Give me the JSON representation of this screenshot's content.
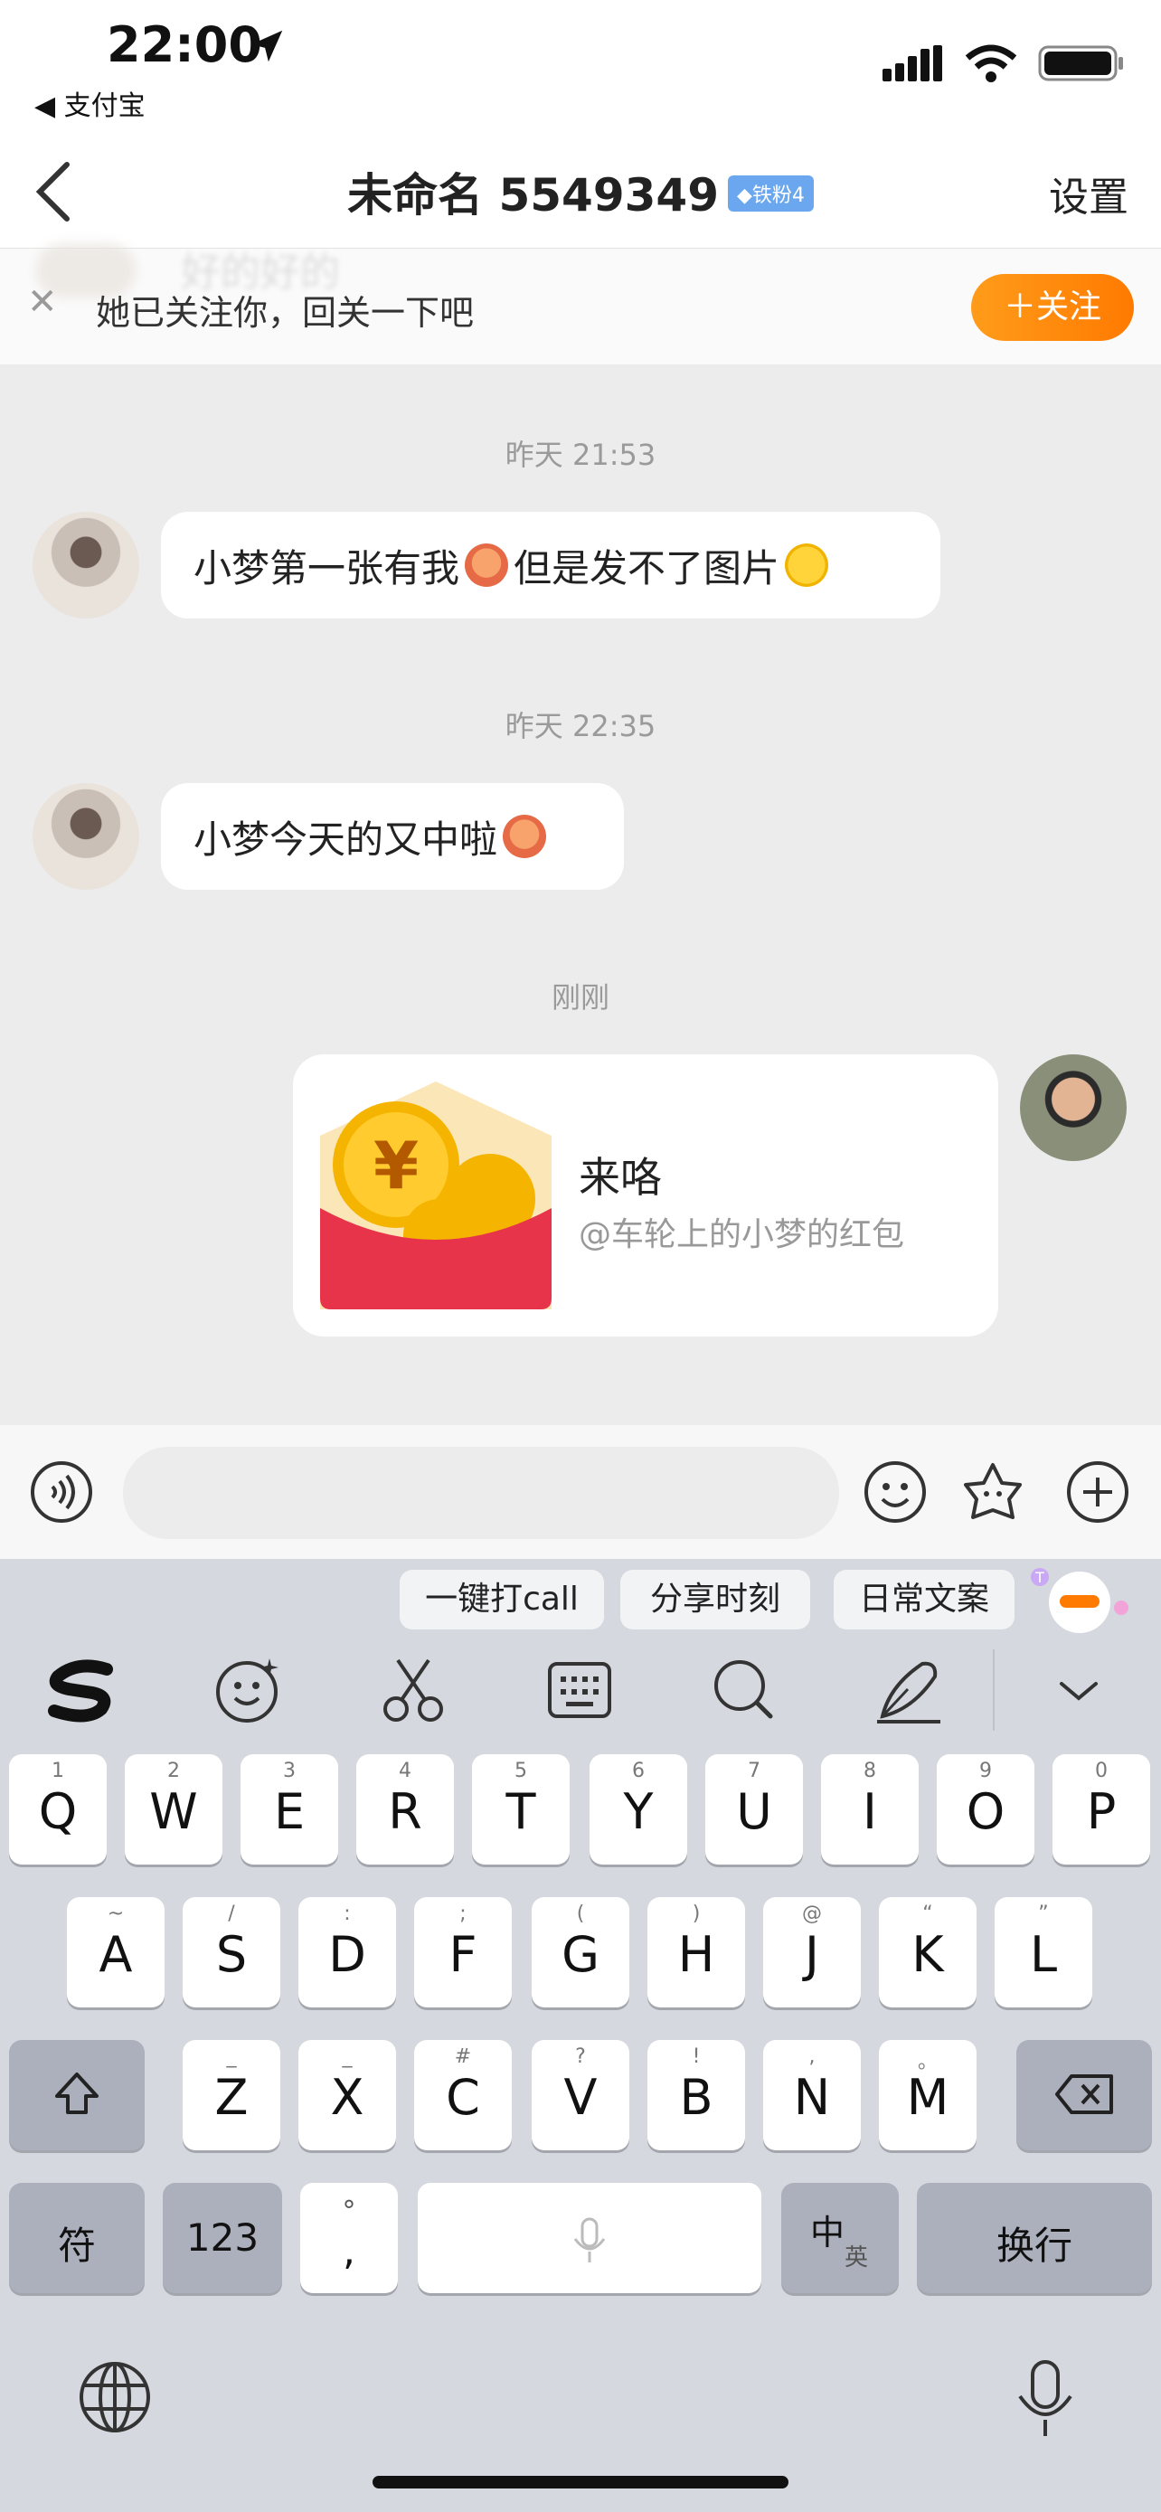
{
  "status_bar": {
    "time": "22:00",
    "back_app": "◀ 支付宝"
  },
  "nav": {
    "title": "未命名 5549349",
    "fan_badge": "◆铁粉4",
    "settings": "设置"
  },
  "follow_banner": {
    "blurred_text": "好的好的",
    "text": "她已关注你，回关一下吧",
    "follow_button": "＋关注"
  },
  "messages": [
    {
      "timestamp": "昨天 21:53",
      "text_before": "小梦第一张有我",
      "text_after": "但是发不了图片"
    },
    {
      "timestamp": "昨天 22:35",
      "text": "小梦今天的又中啦"
    },
    {
      "timestamp": "刚刚",
      "red_packet": {
        "title": "来咯",
        "subtitle": "@车轮上的小梦的红包"
      }
    }
  ],
  "input": {
    "placeholder": ""
  },
  "keyboard": {
    "suggestions": [
      "一键打call",
      "分享时刻",
      "日常文案"
    ],
    "row1": [
      {
        "k": "Q",
        "h": "1"
      },
      {
        "k": "W",
        "h": "2"
      },
      {
        "k": "E",
        "h": "3"
      },
      {
        "k": "R",
        "h": "4"
      },
      {
        "k": "T",
        "h": "5"
      },
      {
        "k": "Y",
        "h": "6"
      },
      {
        "k": "U",
        "h": "7"
      },
      {
        "k": "I",
        "h": "8"
      },
      {
        "k": "O",
        "h": "9"
      },
      {
        "k": "P",
        "h": "0"
      }
    ],
    "row2": [
      {
        "k": "A",
        "h": "~"
      },
      {
        "k": "S",
        "h": "/"
      },
      {
        "k": "D",
        "h": ":"
      },
      {
        "k": "F",
        "h": ";"
      },
      {
        "k": "G",
        "h": "("
      },
      {
        "k": "H",
        "h": ")"
      },
      {
        "k": "J",
        "h": "@"
      },
      {
        "k": "K",
        "h": "“"
      },
      {
        "k": "L",
        "h": "”"
      }
    ],
    "row3": [
      {
        "k": "Z",
        "h": "_"
      },
      {
        "k": "X",
        "h": "_"
      },
      {
        "k": "C",
        "h": "#"
      },
      {
        "k": "V",
        "h": "?"
      },
      {
        "k": "B",
        "h": "!"
      },
      {
        "k": "N",
        "h": ","
      },
      {
        "k": "M",
        "h": "。"
      }
    ],
    "fu": "符",
    "num": "123",
    "punct_top": "°",
    "punct_bottom": ",",
    "zh": "中",
    "en": "英",
    "enter": "换行"
  },
  "colors": {
    "accent": "#ff8a00",
    "badge": "#6aa7ef",
    "red_packet": "#e8344a",
    "coin": "#f5b400"
  }
}
